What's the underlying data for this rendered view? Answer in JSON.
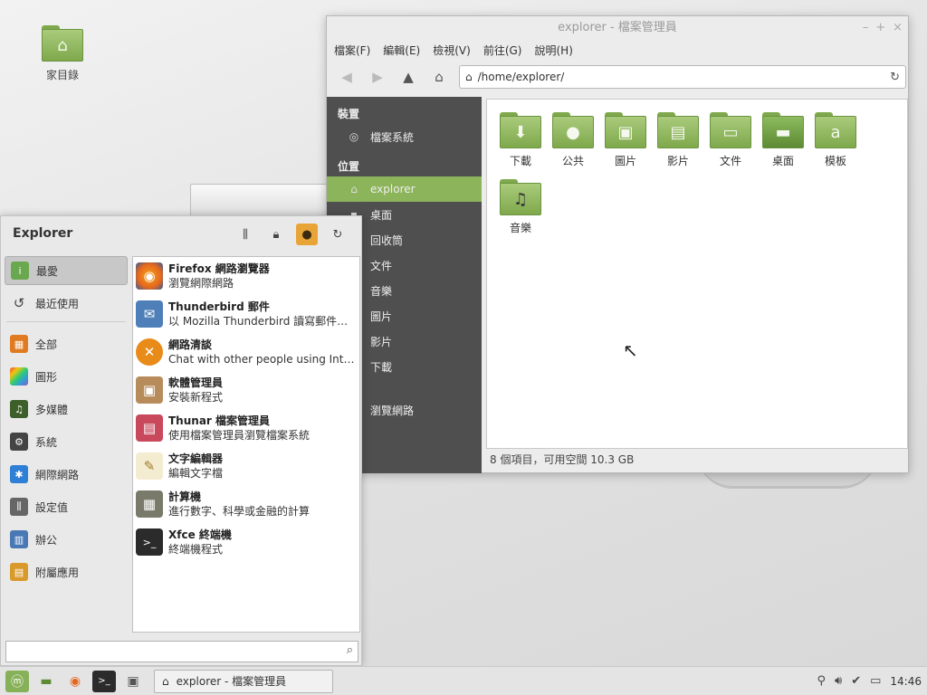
{
  "desktop": {
    "home_label": "家目錄"
  },
  "file_manager": {
    "title": "explorer - 檔案管理員",
    "menu": [
      "檔案(F)",
      "編輯(E)",
      "檢視(V)",
      "前往(G)",
      "說明(H)"
    ],
    "path": "/home/explorer/",
    "sidebar": {
      "devices_header": "裝置",
      "devices": [
        {
          "label": "檔案系統",
          "icon": "drive-icon"
        }
      ],
      "places_header": "位置",
      "places": [
        {
          "label": "explorer",
          "icon": "home-icon"
        },
        {
          "label": "桌面",
          "icon": "folder-icon"
        },
        {
          "label": "回收筒",
          "icon": "trash-icon"
        },
        {
          "label": "文件",
          "icon": "folder-icon"
        },
        {
          "label": "音樂",
          "icon": "folder-icon"
        },
        {
          "label": "圖片",
          "icon": "folder-icon"
        },
        {
          "label": "影片",
          "icon": "folder-icon"
        },
        {
          "label": "下載",
          "icon": "folder-icon"
        }
      ],
      "network": [
        {
          "label": "瀏覽網路",
          "icon": "network-icon"
        }
      ]
    },
    "files": [
      {
        "label": "下載",
        "icon": "download-folder-icon"
      },
      {
        "label": "公共",
        "icon": "public-folder-icon"
      },
      {
        "label": "圖片",
        "icon": "pictures-folder-icon"
      },
      {
        "label": "影片",
        "icon": "videos-folder-icon"
      },
      {
        "label": "文件",
        "icon": "documents-folder-icon"
      },
      {
        "label": "桌面",
        "icon": "desktop-folder-icon"
      },
      {
        "label": "模板",
        "icon": "templates-folder-icon"
      },
      {
        "label": "音樂",
        "icon": "music-folder-icon"
      }
    ],
    "status": "8 個項目，可用空間 10.3 GB"
  },
  "menu": {
    "user": "Explorer",
    "categories": [
      {
        "label": "最愛",
        "icon": "favorites-icon",
        "color": "#6aa84f"
      },
      {
        "label": "最近使用",
        "icon": "history-icon",
        "color": "#555555"
      },
      {
        "label": "全部",
        "icon": "all-apps-icon",
        "color": "#e07b22"
      },
      {
        "label": "圖形",
        "icon": "graphics-icon",
        "color": "#c84fb0"
      },
      {
        "label": "多媒體",
        "icon": "multimedia-icon",
        "color": "#3d5f2a"
      },
      {
        "label": "系統",
        "icon": "system-icon",
        "color": "#444444"
      },
      {
        "label": "網際網路",
        "icon": "internet-icon",
        "color": "#2f7fd6"
      },
      {
        "label": "設定值",
        "icon": "settings-icon",
        "color": "#666666"
      },
      {
        "label": "辦公",
        "icon": "office-icon",
        "color": "#4a78b4"
      },
      {
        "label": "附屬應用",
        "icon": "accessories-icon",
        "color": "#d99a2b"
      }
    ],
    "apps": [
      {
        "name": "Firefox 網路瀏覽器",
        "desc": "瀏覽網際網路",
        "icon": "firefox-icon",
        "color": "#e5681e"
      },
      {
        "name": "Thunderbird 郵件",
        "desc": "以 Mozilla Thunderbird 讀寫郵件或...",
        "icon": "thunderbird-icon",
        "color": "#4f7fb8"
      },
      {
        "name": "網路清談",
        "desc": "Chat with other people using Intern...",
        "icon": "chat-icon",
        "color": "#e88b18"
      },
      {
        "name": "軟體管理員",
        "desc": "安裝新程式",
        "icon": "package-icon",
        "color": "#b88c5a"
      },
      {
        "name": "Thunar 檔案管理員",
        "desc": "使用檔案管理員瀏覽檔案系統",
        "icon": "file-manager-icon",
        "color": "#c9485b"
      },
      {
        "name": "文字編輯器",
        "desc": "編輯文字檔",
        "icon": "text-editor-icon",
        "color": "#d9b44a"
      },
      {
        "name": "計算機",
        "desc": "進行數字、科學或金融的計算",
        "icon": "calculator-icon",
        "color": "#7a7a6a"
      },
      {
        "name": "Xfce 終端機",
        "desc": "終端機程式",
        "icon": "terminal-icon",
        "color": "#2b2b2b"
      }
    ],
    "search_placeholder": ""
  },
  "taskbar": {
    "task_label": "explorer - 檔案管理員",
    "clock": "14:46"
  }
}
